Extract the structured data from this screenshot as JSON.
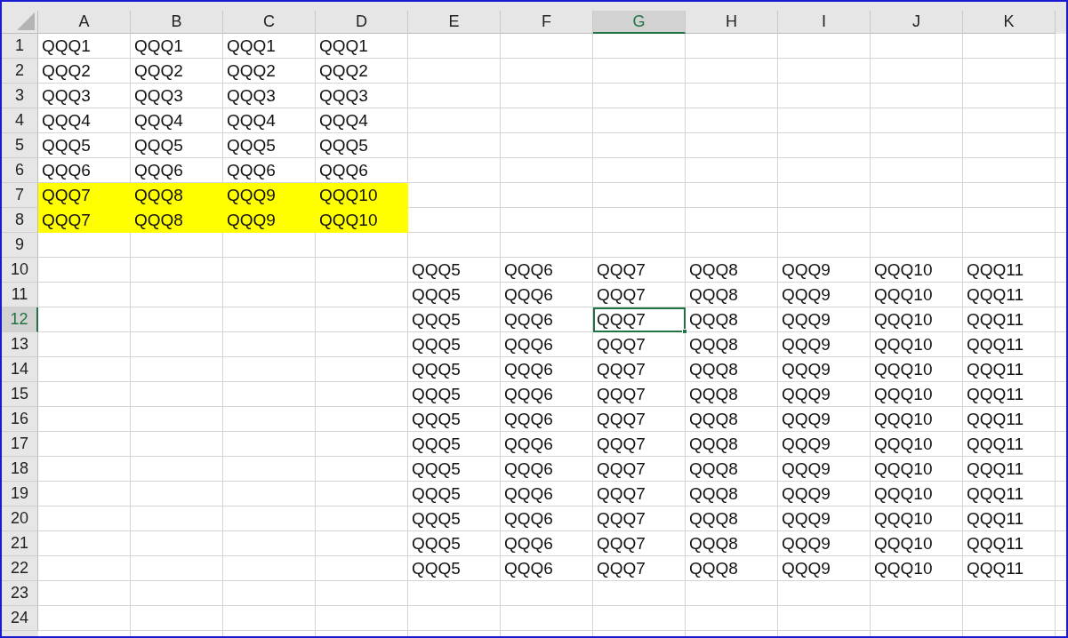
{
  "columns": [
    {
      "label": "A",
      "selected": false
    },
    {
      "label": "B",
      "selected": false
    },
    {
      "label": "C",
      "selected": false
    },
    {
      "label": "D",
      "selected": false
    },
    {
      "label": "E",
      "selected": false
    },
    {
      "label": "F",
      "selected": false
    },
    {
      "label": "G",
      "selected": true
    },
    {
      "label": "H",
      "selected": false
    },
    {
      "label": "I",
      "selected": false
    },
    {
      "label": "J",
      "selected": false
    },
    {
      "label": "K",
      "selected": false
    }
  ],
  "rows": [
    {
      "header": "1",
      "selected": false,
      "cells": [
        {
          "text": "QQQ1",
          "selected": false
        },
        {
          "text": "QQQ1",
          "selected": false
        },
        {
          "text": "QQQ1",
          "selected": false
        },
        {
          "text": "QQQ1",
          "selected": false
        }
      ]
    },
    {
      "header": "2",
      "selected": false,
      "cells": [
        {
          "text": "QQQ2",
          "selected": false
        },
        {
          "text": "QQQ2",
          "selected": false
        },
        {
          "text": "QQQ2",
          "selected": false
        },
        {
          "text": "QQQ2",
          "selected": false
        }
      ]
    },
    {
      "header": "3",
      "selected": false,
      "cells": [
        {
          "text": "QQQ3",
          "selected": false
        },
        {
          "text": "QQQ3",
          "selected": false
        },
        {
          "text": "QQQ3",
          "selected": false
        },
        {
          "text": "QQQ3",
          "selected": false
        }
      ]
    },
    {
      "header": "4",
      "selected": false,
      "cells": [
        {
          "text": "QQQ4",
          "selected": false
        },
        {
          "text": "QQQ4",
          "selected": false
        },
        {
          "text": "QQQ4",
          "selected": false
        },
        {
          "text": "QQQ4",
          "selected": false
        }
      ]
    },
    {
      "header": "5",
      "selected": false,
      "cells": [
        {
          "text": "QQQ5",
          "selected": false
        },
        {
          "text": "QQQ5",
          "selected": false
        },
        {
          "text": "QQQ5",
          "selected": false
        },
        {
          "text": "QQQ5",
          "selected": false
        }
      ]
    },
    {
      "header": "6",
      "selected": false,
      "cells": [
        {
          "text": "QQQ6",
          "selected": false
        },
        {
          "text": "QQQ6",
          "selected": false
        },
        {
          "text": "QQQ6",
          "selected": false
        },
        {
          "text": "QQQ6",
          "selected": false
        }
      ]
    },
    {
      "header": "7",
      "selected": false,
      "cells": [
        {
          "text": "QQQ7",
          "selected": false,
          "color": "#ffff00"
        },
        {
          "text": "QQQ8",
          "selected": false,
          "color": "#ffff00"
        },
        {
          "text": "QQQ9",
          "selected": false,
          "color": "#ffff00"
        },
        {
          "text": "QQQ10",
          "selected": false,
          "color": "#ffff00"
        }
      ]
    },
    {
      "header": "8",
      "selected": false,
      "cells": [
        {
          "text": "QQQ7",
          "selected": false,
          "color": "#ffff00"
        },
        {
          "text": "QQQ8",
          "selected": false,
          "color": "#ffff00"
        },
        {
          "text": "QQQ9",
          "selected": false,
          "color": "#ffff00"
        },
        {
          "text": "QQQ10",
          "selected": false,
          "color": "#ffff00"
        }
      ]
    },
    {
      "header": "9",
      "selected": false,
      "cells": []
    },
    {
      "header": "10",
      "selected": false,
      "cells": [
        null,
        null,
        null,
        null,
        {
          "text": "QQQ5",
          "selected": false
        },
        {
          "text": "QQQ6",
          "selected": false
        },
        {
          "text": "QQQ7",
          "selected": false
        },
        {
          "text": "QQQ8",
          "selected": false
        },
        {
          "text": "QQQ9",
          "selected": false
        },
        {
          "text": "QQQ10",
          "selected": false
        },
        {
          "text": "QQQ11",
          "selected": false
        }
      ]
    },
    {
      "header": "11",
      "selected": false,
      "cells": [
        null,
        null,
        null,
        null,
        {
          "text": "QQQ5",
          "selected": false
        },
        {
          "text": "QQQ6",
          "selected": false
        },
        {
          "text": "QQQ7",
          "selected": false
        },
        {
          "text": "QQQ8",
          "selected": false
        },
        {
          "text": "QQQ9",
          "selected": false
        },
        {
          "text": "QQQ10",
          "selected": false
        },
        {
          "text": "QQQ11",
          "selected": false
        }
      ]
    },
    {
      "header": "12",
      "selected": true,
      "cells": [
        null,
        null,
        null,
        null,
        {
          "text": "QQQ5",
          "selected": false
        },
        {
          "text": "QQQ6",
          "selected": false
        },
        {
          "text": "QQQ7",
          "selected": true
        },
        {
          "text": "QQQ8",
          "selected": false
        },
        {
          "text": "QQQ9",
          "selected": false
        },
        {
          "text": "QQQ10",
          "selected": false
        },
        {
          "text": "QQQ11",
          "selected": false
        }
      ]
    },
    {
      "header": "13",
      "selected": false,
      "cells": [
        null,
        null,
        null,
        null,
        {
          "text": "QQQ5",
          "selected": false
        },
        {
          "text": "QQQ6",
          "selected": false
        },
        {
          "text": "QQQ7",
          "selected": false
        },
        {
          "text": "QQQ8",
          "selected": false
        },
        {
          "text": "QQQ9",
          "selected": false
        },
        {
          "text": "QQQ10",
          "selected": false
        },
        {
          "text": "QQQ11",
          "selected": false
        }
      ]
    },
    {
      "header": "14",
      "selected": false,
      "cells": [
        null,
        null,
        null,
        null,
        {
          "text": "QQQ5",
          "selected": false
        },
        {
          "text": "QQQ6",
          "selected": false
        },
        {
          "text": "QQQ7",
          "selected": false
        },
        {
          "text": "QQQ8",
          "selected": false
        },
        {
          "text": "QQQ9",
          "selected": false
        },
        {
          "text": "QQQ10",
          "selected": false
        },
        {
          "text": "QQQ11",
          "selected": false
        }
      ]
    },
    {
      "header": "15",
      "selected": false,
      "cells": [
        null,
        null,
        null,
        null,
        {
          "text": "QQQ5",
          "selected": false
        },
        {
          "text": "QQQ6",
          "selected": false
        },
        {
          "text": "QQQ7",
          "selected": false
        },
        {
          "text": "QQQ8",
          "selected": false
        },
        {
          "text": "QQQ9",
          "selected": false
        },
        {
          "text": "QQQ10",
          "selected": false
        },
        {
          "text": "QQQ11",
          "selected": false
        }
      ]
    },
    {
      "header": "16",
      "selected": false,
      "cells": [
        null,
        null,
        null,
        null,
        {
          "text": "QQQ5",
          "selected": false
        },
        {
          "text": "QQQ6",
          "selected": false
        },
        {
          "text": "QQQ7",
          "selected": false
        },
        {
          "text": "QQQ8",
          "selected": false
        },
        {
          "text": "QQQ9",
          "selected": false
        },
        {
          "text": "QQQ10",
          "selected": false
        },
        {
          "text": "QQQ11",
          "selected": false
        }
      ]
    },
    {
      "header": "17",
      "selected": false,
      "cells": [
        null,
        null,
        null,
        null,
        {
          "text": "QQQ5",
          "selected": false
        },
        {
          "text": "QQQ6",
          "selected": false
        },
        {
          "text": "QQQ7",
          "selected": false
        },
        {
          "text": "QQQ8",
          "selected": false
        },
        {
          "text": "QQQ9",
          "selected": false
        },
        {
          "text": "QQQ10",
          "selected": false
        },
        {
          "text": "QQQ11",
          "selected": false
        }
      ]
    },
    {
      "header": "18",
      "selected": false,
      "cells": [
        null,
        null,
        null,
        null,
        {
          "text": "QQQ5",
          "selected": false
        },
        {
          "text": "QQQ6",
          "selected": false
        },
        {
          "text": "QQQ7",
          "selected": false
        },
        {
          "text": "QQQ8",
          "selected": false
        },
        {
          "text": "QQQ9",
          "selected": false
        },
        {
          "text": "QQQ10",
          "selected": false
        },
        {
          "text": "QQQ11",
          "selected": false
        }
      ]
    },
    {
      "header": "19",
      "selected": false,
      "cells": [
        null,
        null,
        null,
        null,
        {
          "text": "QQQ5",
          "selected": false
        },
        {
          "text": "QQQ6",
          "selected": false
        },
        {
          "text": "QQQ7",
          "selected": false
        },
        {
          "text": "QQQ8",
          "selected": false
        },
        {
          "text": "QQQ9",
          "selected": false
        },
        {
          "text": "QQQ10",
          "selected": false
        },
        {
          "text": "QQQ11",
          "selected": false
        }
      ]
    },
    {
      "header": "20",
      "selected": false,
      "cells": [
        null,
        null,
        null,
        null,
        {
          "text": "QQQ5",
          "selected": false
        },
        {
          "text": "QQQ6",
          "selected": false
        },
        {
          "text": "QQQ7",
          "selected": false
        },
        {
          "text": "QQQ8",
          "selected": false
        },
        {
          "text": "QQQ9",
          "selected": false
        },
        {
          "text": "QQQ10",
          "selected": false
        },
        {
          "text": "QQQ11",
          "selected": false
        }
      ]
    },
    {
      "header": "21",
      "selected": false,
      "cells": [
        null,
        null,
        null,
        null,
        {
          "text": "QQQ5",
          "selected": false
        },
        {
          "text": "QQQ6",
          "selected": false
        },
        {
          "text": "QQQ7",
          "selected": false
        },
        {
          "text": "QQQ8",
          "selected": false
        },
        {
          "text": "QQQ9",
          "selected": false
        },
        {
          "text": "QQQ10",
          "selected": false
        },
        {
          "text": "QQQ11",
          "selected": false
        }
      ]
    },
    {
      "header": "22",
      "selected": false,
      "cells": [
        null,
        null,
        null,
        null,
        {
          "text": "QQQ5",
          "selected": false
        },
        {
          "text": "QQQ6",
          "selected": false
        },
        {
          "text": "QQQ7",
          "selected": false
        },
        {
          "text": "QQQ8",
          "selected": false
        },
        {
          "text": "QQQ9",
          "selected": false
        },
        {
          "text": "QQQ10",
          "selected": false
        },
        {
          "text": "QQQ11",
          "selected": false
        }
      ]
    },
    {
      "header": "23",
      "selected": false,
      "cells": []
    },
    {
      "header": "24",
      "selected": false,
      "cells": []
    }
  ]
}
